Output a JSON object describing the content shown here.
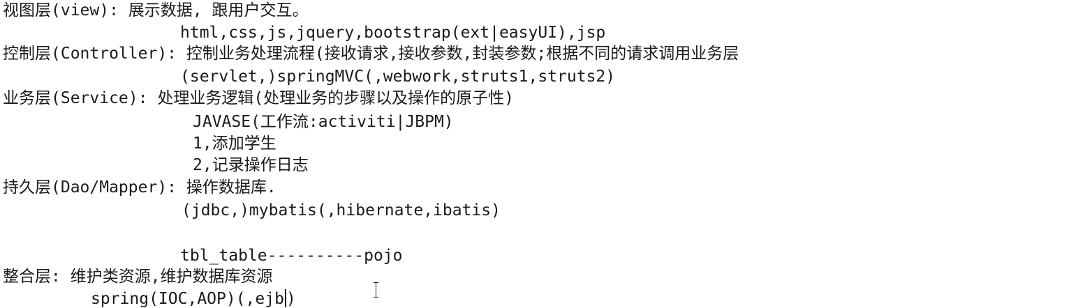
{
  "document": {
    "lines": [
      "视图层(view): 展示数据, 跟用户交互。",
      "html,css,js,jquery,bootstrap(ext|easyUI),jsp",
      "控制层(Controller): 控制业务处理流程(接收请求,接收参数,封装参数;根据不同的请求调用业务层",
      "(servlet,)springMVC(,webwork,struts1,struts2)",
      "业务层(Service): 处理业务逻辑(处理业务的步骤以及操作的原子性)",
      "JAVASE(工作流:activiti|JBPM)",
      "1,添加学生",
      "2,记录操作日志",
      "持久层(Dao/Mapper): 操作数据库.",
      "(jdbc,)mybatis(,hibernate,ibatis)",
      "tbl_table----------pojo",
      "整合层: 维护类资源,维护数据库资源",
      "spring(IOC,AOP)(,ejb"
    ],
    "caret_after_line": "spring(IOC,AOP)(,ejb",
    "closing_paren": ")"
  },
  "colors": {
    "background": "#ffffff",
    "text": "#1a1a1a"
  }
}
